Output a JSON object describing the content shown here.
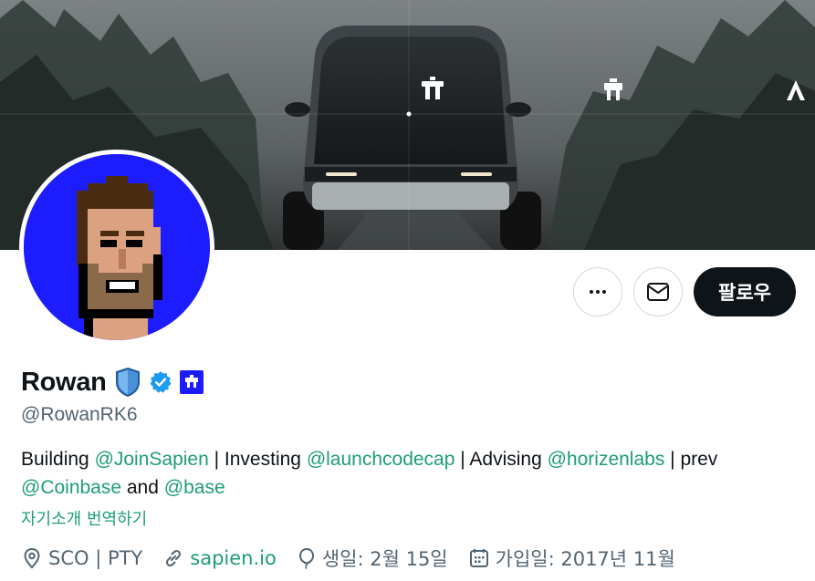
{
  "profile": {
    "name": "Rowan",
    "handle": "@RowanRK6",
    "verified": true
  },
  "actions": {
    "more_icon": "more-horizontal-icon",
    "message_icon": "mail-icon",
    "follow_label": "팔로우"
  },
  "bio": {
    "t1": "Building ",
    "m1": "@JoinSapien",
    "t2": " | Investing ",
    "m2": "@launchcodecap",
    "t3": " | Advising ",
    "m3": "@horizenlabs",
    "t4": " | prev ",
    "m4": "@Coinbase",
    "t5": " and ",
    "m5": "@base"
  },
  "translate_label": "자기소개 번역하기",
  "meta": {
    "location": "SCO | PTY",
    "website": "sapien.io",
    "birthday": "생일: 2월 15일",
    "joined": "가입일: 2017년 11월"
  },
  "colors": {
    "accent": "#1d9e74",
    "verified": "#1d9bf0",
    "follow_bg": "#0f1419",
    "avatar_bg": "#1c1cff"
  }
}
